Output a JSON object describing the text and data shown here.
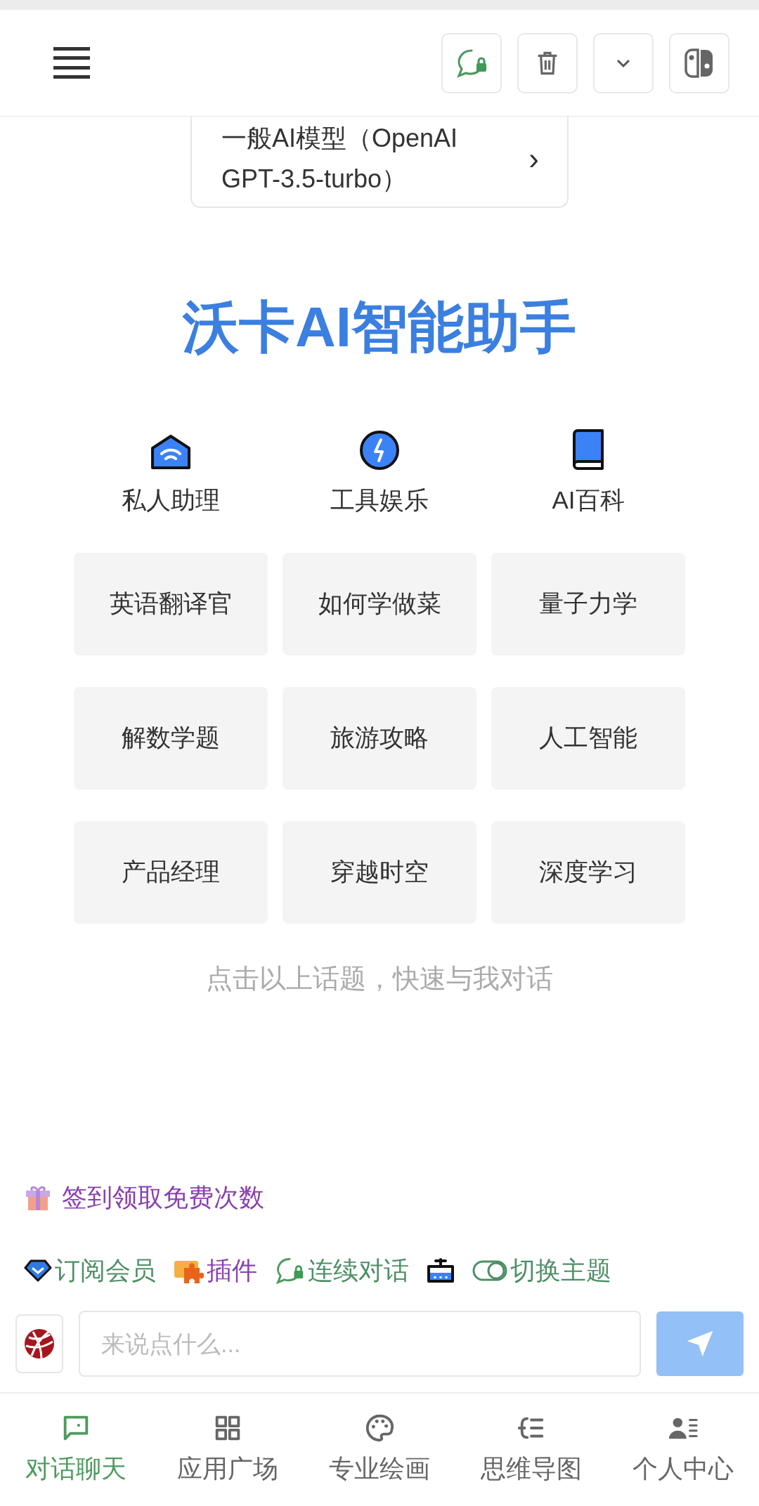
{
  "model_selector": {
    "label": "一般AI模型（OpenAI GPT-3.5-turbo）",
    "chevron": "›"
  },
  "title": "沃卡AI智能助手",
  "categories": [
    {
      "kind": "home",
      "label": "私人助理"
    },
    {
      "kind": "bolt",
      "label": "工具娱乐"
    },
    {
      "kind": "book",
      "label": "AI百科"
    }
  ],
  "topics": [
    "英语翻译官",
    "如何学做菜",
    "量子力学",
    "解数学题",
    "旅游攻略",
    "人工智能",
    "产品经理",
    "穿越时空",
    "深度学习"
  ],
  "hint": "点击以上话题，快速与我对话",
  "checkin": {
    "label": "签到领取免费次数"
  },
  "toolbar": [
    {
      "kind": "diamond",
      "label": "订阅会员",
      "color": "#4e8f66"
    },
    {
      "kind": "puzzle",
      "label": "插件",
      "color": "#8a3fb0"
    },
    {
      "kind": "chat-lock",
      "label": "连续对话",
      "color": "#4e8f66"
    },
    {
      "kind": "basket"
    },
    {
      "kind": "toggle",
      "label": "切换主题",
      "color": "#4e8f66"
    }
  ],
  "input": {
    "placeholder": "来说点什么..."
  },
  "nav": [
    {
      "kind": "chat",
      "label": "对话聊天",
      "selected": true
    },
    {
      "kind": "grid",
      "label": "应用广场",
      "selected": false
    },
    {
      "kind": "palette",
      "label": "专业绘画",
      "selected": false
    },
    {
      "kind": "mindmap",
      "label": "思维导图",
      "selected": false
    },
    {
      "kind": "user",
      "label": "个人中心",
      "selected": false
    }
  ]
}
